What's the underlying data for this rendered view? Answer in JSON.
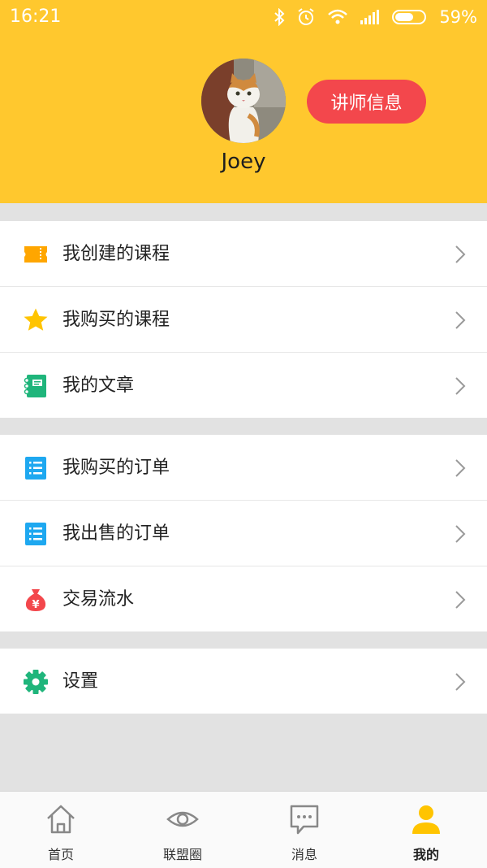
{
  "status_bar": {
    "time": "16:21",
    "battery": "59%"
  },
  "profile": {
    "name": "Joey",
    "teacher_button": "讲师信息"
  },
  "menu_groups": [
    {
      "items": [
        {
          "label": "我创建的课程",
          "icon": "ticket-icon"
        },
        {
          "label": "我购买的课程",
          "icon": "star-icon"
        },
        {
          "label": "我的文章",
          "icon": "notebook-icon"
        }
      ]
    },
    {
      "items": [
        {
          "label": "我购买的订单",
          "icon": "list-icon"
        },
        {
          "label": "我出售的订单",
          "icon": "list-icon"
        },
        {
          "label": "交易流水",
          "icon": "money-bag-icon"
        }
      ]
    },
    {
      "items": [
        {
          "label": "设置",
          "icon": "gear-icon"
        }
      ]
    }
  ],
  "tabs": [
    {
      "label": "首页",
      "icon": "home-icon",
      "active": false
    },
    {
      "label": "联盟圈",
      "icon": "eye-icon",
      "active": false
    },
    {
      "label": "消息",
      "icon": "message-icon",
      "active": false
    },
    {
      "label": "我的",
      "icon": "person-icon",
      "active": true
    }
  ],
  "colors": {
    "header": "#ffc82e",
    "teacher_button": "#f3474c",
    "ticket": "#ffa600",
    "star": "#ffc400",
    "notebook": "#1fb57b",
    "list": "#1ea8f0",
    "money_bag": "#f3474c",
    "gear": "#1fb57b",
    "tab_active": "#ffc400",
    "tab_inactive": "#888888"
  }
}
